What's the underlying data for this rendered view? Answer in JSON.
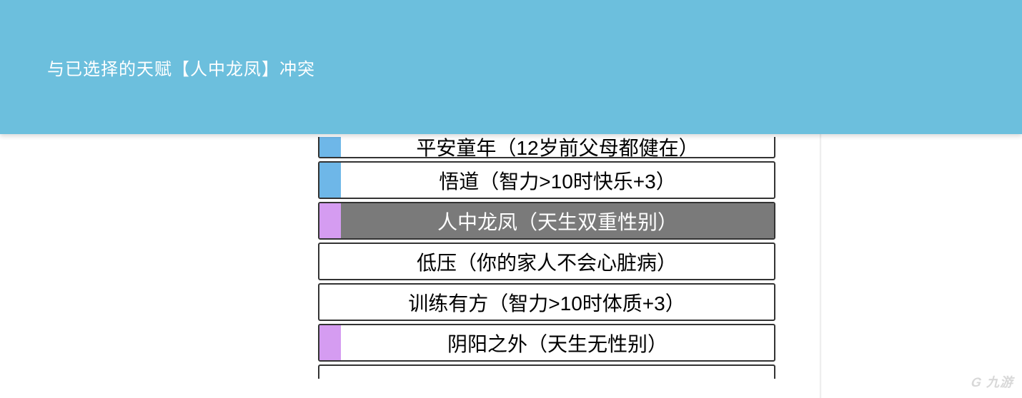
{
  "banner": {
    "message": "与已选择的天赋【人中龙凤】冲突"
  },
  "talents": [
    {
      "label": "平安童年（12岁前父母都健在）",
      "rarity": "blue",
      "selected": false,
      "partial": "top"
    },
    {
      "label": "悟道（智力>10时快乐+3）",
      "rarity": "blue",
      "selected": false
    },
    {
      "label": "人中龙凤（天生双重性别）",
      "rarity": "purple",
      "selected": true
    },
    {
      "label": "低压（你的家人不会心脏病）",
      "rarity": "none",
      "selected": false
    },
    {
      "label": "训练有方（智力>10时体质+3）",
      "rarity": "none",
      "selected": false
    },
    {
      "label": "阴阳之外（天生无性别）",
      "rarity": "purple",
      "selected": false
    },
    {
      "label": "",
      "rarity": "none",
      "selected": false,
      "partial": "bottom"
    }
  ],
  "watermark": {
    "text": "九游"
  }
}
